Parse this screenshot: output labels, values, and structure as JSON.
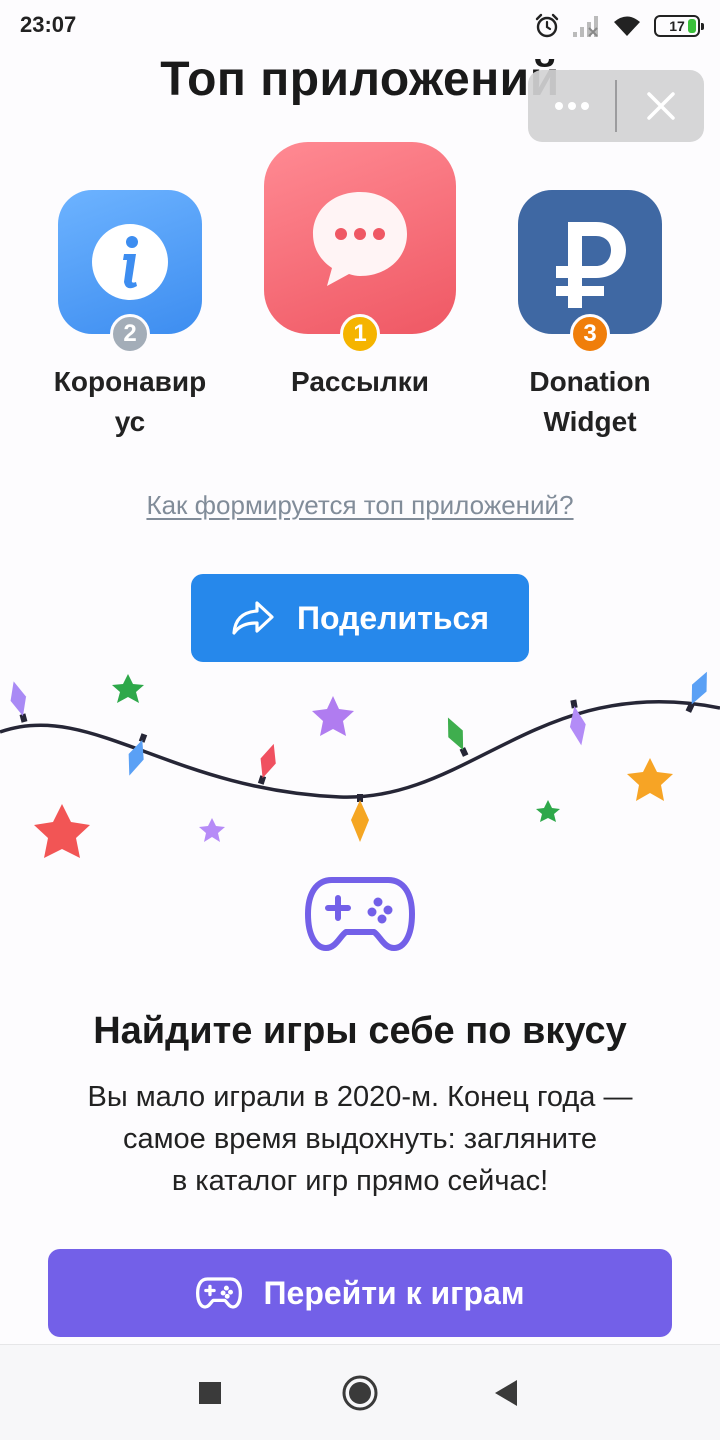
{
  "status_bar": {
    "time": "23:07",
    "battery": "17",
    "icons": [
      "alarm-icon",
      "signal-icon",
      "wifi-icon",
      "battery-icon"
    ]
  },
  "header": {
    "title": "Топ приложений",
    "menu_icon": "more-dots-icon",
    "close_icon": "close-icon"
  },
  "top_apps": [
    {
      "rank": "1",
      "name": "Рассылки",
      "icon": "chat-bubble-icon",
      "color": "#f05a66",
      "badge_color": "#f5b400"
    },
    {
      "rank": "2",
      "name_line1": "Коронавир",
      "name_line2": "ус",
      "icon": "info-icon",
      "color": "#4a98f4",
      "badge_color": "#a3adb8"
    },
    {
      "rank": "3",
      "name_line1": "Donation",
      "name_line2": "Widget",
      "icon": "ruble-icon",
      "color": "#3f68a3",
      "badge_color": "#f07e0a"
    }
  ],
  "how_link": "Как формируется топ приложений?",
  "share_button": {
    "label": "Поделиться",
    "icon": "share-arrow-icon",
    "color": "#2688eb"
  },
  "games": {
    "icon": "gamepad-icon",
    "title": "Найдите игры себе по вкусу",
    "text_line1": "Вы мало играли в 2020-м. Конец года —",
    "text_line2": "самое время выдохнуть: загляните",
    "text_line3": "в каталог игр прямо сейчас!",
    "button_label": "Перейти к играм",
    "button_color": "#7360e8"
  },
  "nav_bar": {
    "recents_icon": "square-icon",
    "home_icon": "circle-icon",
    "back_icon": "back-triangle-icon"
  }
}
